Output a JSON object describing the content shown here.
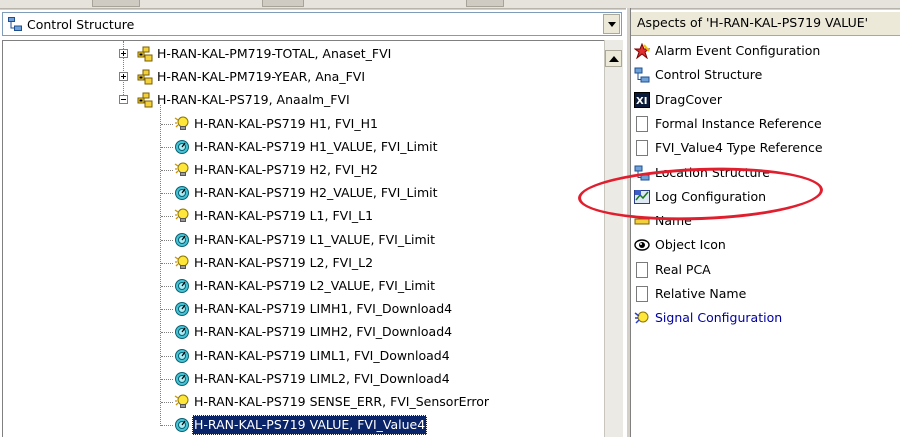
{
  "left_panel": {
    "combo_label": "Control Structure",
    "tree": [
      {
        "label": "H-RAN-KAL-PM719-TOTAL, Anaset_FVI",
        "icon": "object-group-icon",
        "expander": "plus"
      },
      {
        "label": "H-RAN-KAL-PM719-YEAR, Ana_FVI",
        "icon": "object-group-icon",
        "expander": "plus"
      },
      {
        "label": "H-RAN-KAL-PS719, Anaalm_FVI",
        "icon": "object-group-icon",
        "expander": "minus"
      },
      {
        "label": "H-RAN-KAL-PS719 H1, FVI_H1",
        "icon": "bulb-icon"
      },
      {
        "label": "H-RAN-KAL-PS719 H1_VALUE, FVI_Limit",
        "icon": "gauge-icon"
      },
      {
        "label": "H-RAN-KAL-PS719 H2, FVI_H2",
        "icon": "bulb-icon"
      },
      {
        "label": "H-RAN-KAL-PS719 H2_VALUE, FVI_Limit",
        "icon": "gauge-icon"
      },
      {
        "label": "H-RAN-KAL-PS719 L1, FVI_L1",
        "icon": "bulb-icon"
      },
      {
        "label": "H-RAN-KAL-PS719 L1_VALUE, FVI_Limit",
        "icon": "gauge-icon"
      },
      {
        "label": "H-RAN-KAL-PS719 L2, FVI_L2",
        "icon": "bulb-icon"
      },
      {
        "label": "H-RAN-KAL-PS719 L2_VALUE, FVI_Limit",
        "icon": "gauge-icon"
      },
      {
        "label": "H-RAN-KAL-PS719 LIMH1, FVI_Download4",
        "icon": "gauge-icon"
      },
      {
        "label": "H-RAN-KAL-PS719 LIMH2, FVI_Download4",
        "icon": "gauge-icon"
      },
      {
        "label": "H-RAN-KAL-PS719 LIML1, FVI_Download4",
        "icon": "gauge-icon"
      },
      {
        "label": "H-RAN-KAL-PS719 LIML2, FVI_Download4",
        "icon": "gauge-icon"
      },
      {
        "label": "H-RAN-KAL-PS719 SENSE_ERR, FVI_SensorError",
        "icon": "bulb-icon"
      },
      {
        "label": "H-RAN-KAL-PS719 VALUE, FVI_Value4",
        "icon": "gauge-icon",
        "selected": true
      }
    ]
  },
  "right_panel": {
    "header": "Aspects of 'H-RAN-KAL-PS719 VALUE'",
    "aspects": [
      {
        "label": "Alarm Event Configuration",
        "icon": "alarm-event-icon"
      },
      {
        "label": "Control Structure",
        "icon": "structure-icon"
      },
      {
        "label": "DragCover",
        "icon": "dragcover-icon"
      },
      {
        "label": "Formal Instance Reference",
        "icon": "blank-doc-icon"
      },
      {
        "label": "FVI_Value4 Type Reference",
        "icon": "blank-doc-icon"
      },
      {
        "label": "Location Structure",
        "icon": "structure-icon"
      },
      {
        "label": "Log Configuration",
        "icon": "log-config-icon",
        "highlighted": true
      },
      {
        "label": "Name",
        "icon": "name-icon"
      },
      {
        "label": "Object Icon",
        "icon": "eye-icon"
      },
      {
        "label": "Real PCA",
        "icon": "blank-doc-icon"
      },
      {
        "label": "Relative Name",
        "icon": "blank-doc-icon"
      },
      {
        "label": "Signal Configuration",
        "icon": "signal-config-icon",
        "link": true
      }
    ]
  },
  "colors": {
    "selection": "#0a246a",
    "highlight_ellipse": "#e01e2e",
    "link": "#0000a0"
  }
}
